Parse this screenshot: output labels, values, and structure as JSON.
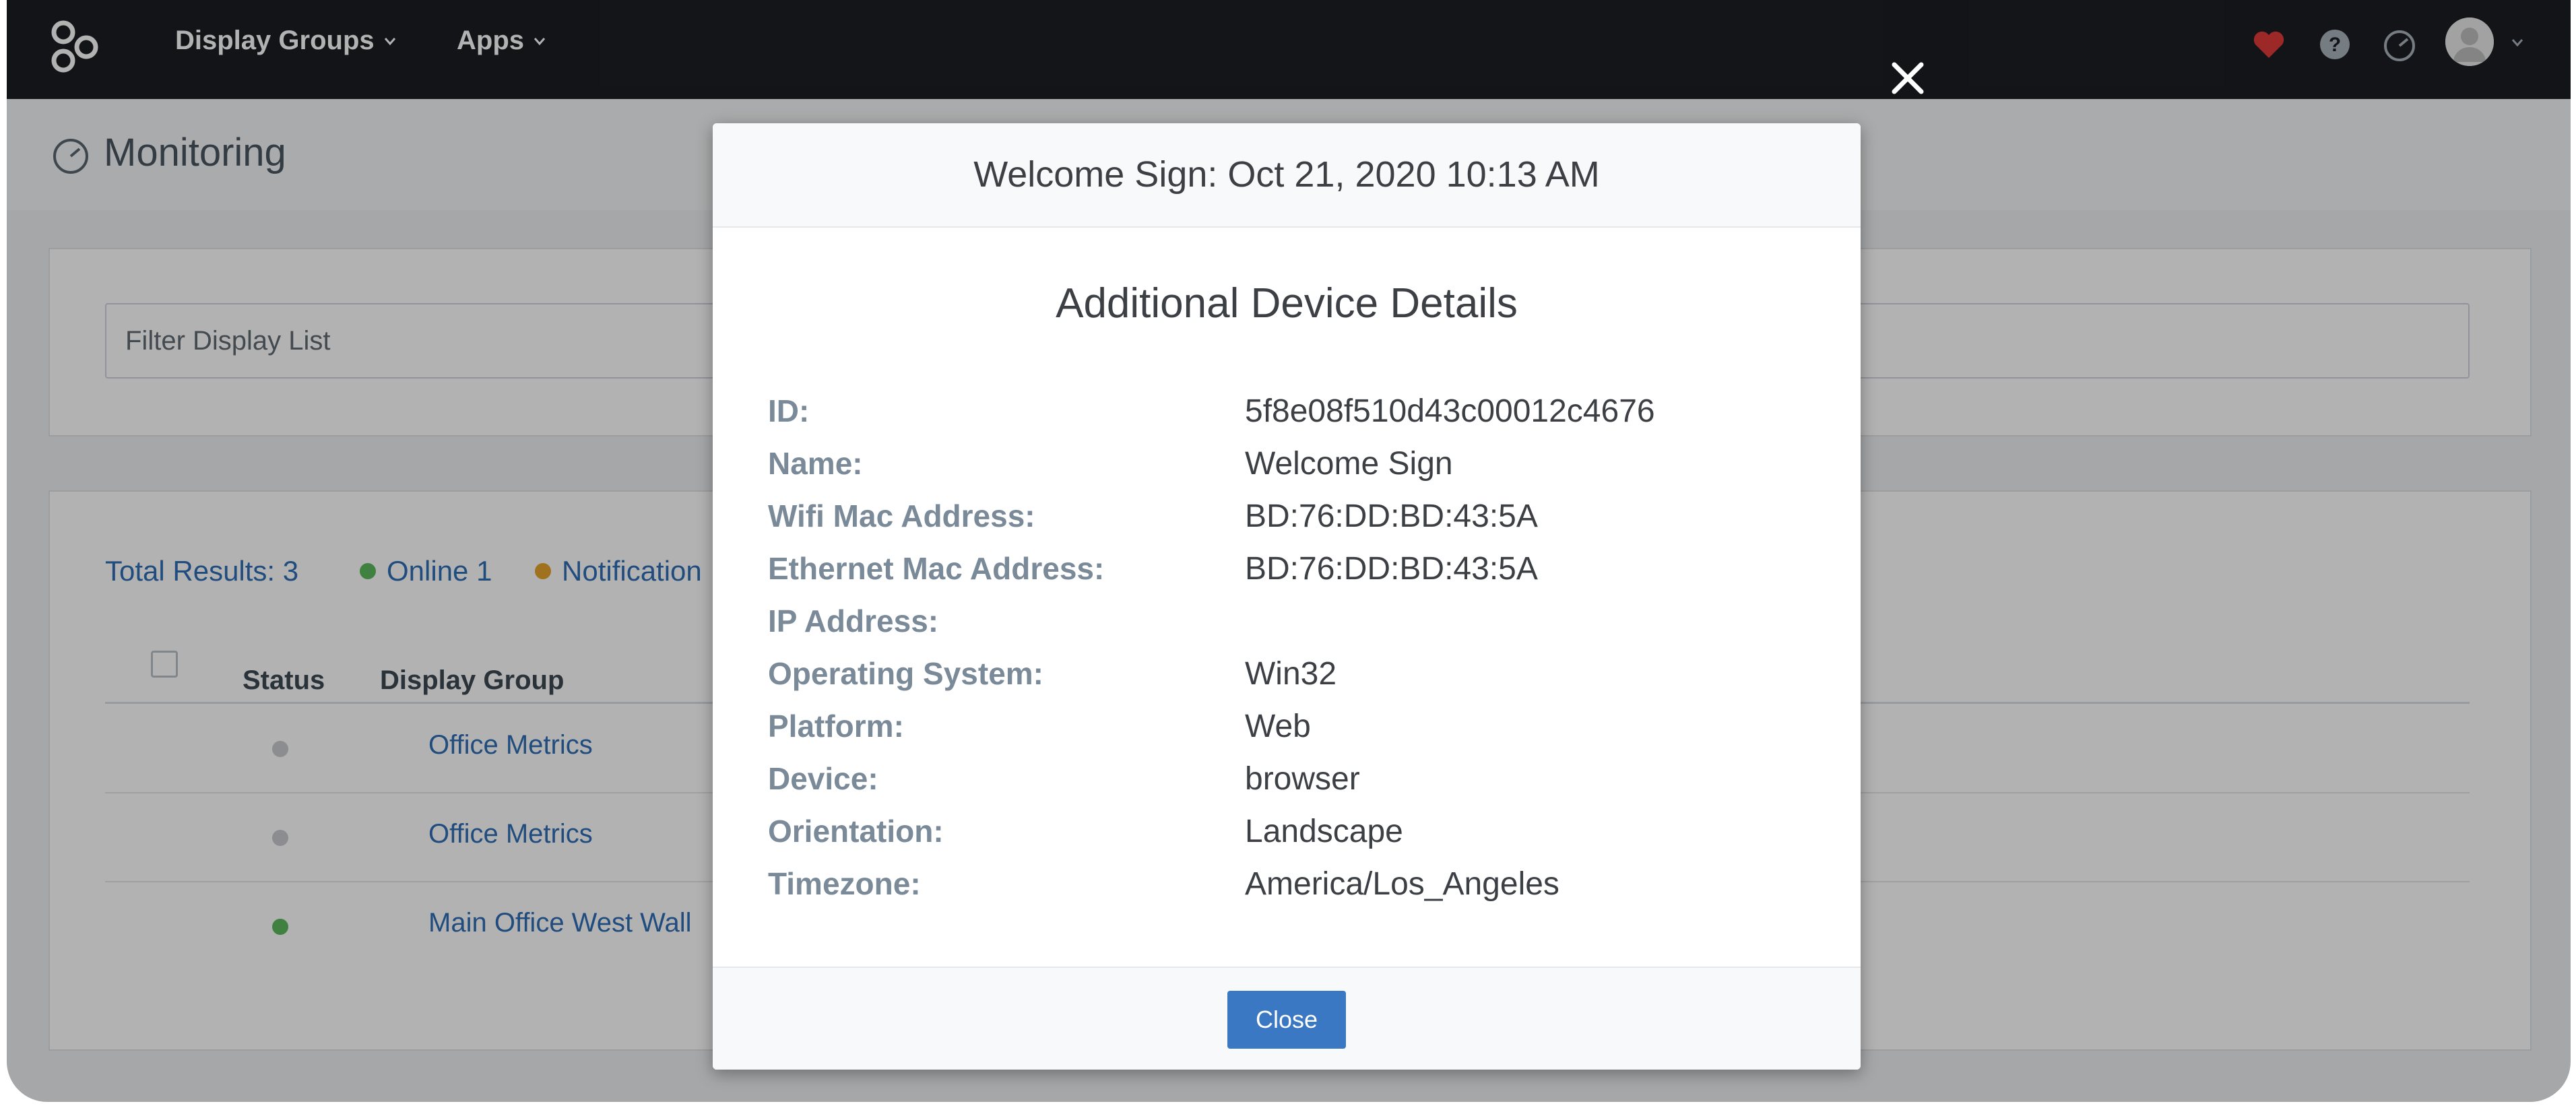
{
  "nav": {
    "display_groups_label": "Display Groups",
    "apps_label": "Apps",
    "heart_color": "#e03a3a"
  },
  "page": {
    "title": "Monitoring"
  },
  "filter": {
    "placeholder": "Filter Display List"
  },
  "summary": {
    "total_results": "Total Results: 3",
    "online": "Online 1",
    "notification": "Notification",
    "online_color": "#5cb85c",
    "notification_color": "#e5a32b"
  },
  "table": {
    "headers": {
      "status": "Status",
      "display_group": "Display Group"
    },
    "rows": [
      {
        "status_color": "#c7cbcf",
        "display_group": "Office Metrics"
      },
      {
        "status_color": "#c7cbcf",
        "display_group": "Office Metrics"
      },
      {
        "status_color": "#5cb85c",
        "display_group": "Main Office West Wall"
      }
    ]
  },
  "modal": {
    "header": "Welcome Sign: Oct 21, 2020 10:13 AM",
    "title": "Additional Device Details",
    "details": [
      {
        "key": "ID:",
        "value": "5f8e08f510d43c00012c4676"
      },
      {
        "key": "Name:",
        "value": "Welcome Sign"
      },
      {
        "key": "Wifi Mac Address:",
        "value": "BD:76:DD:BD:43:5A"
      },
      {
        "key": "Ethernet Mac Address:",
        "value": "BD:76:DD:BD:43:5A"
      },
      {
        "key": "IP Address:",
        "value": ""
      },
      {
        "key": "Operating System:",
        "value": "Win32"
      },
      {
        "key": "Platform:",
        "value": "Web"
      },
      {
        "key": "Device:",
        "value": "browser"
      },
      {
        "key": "Orientation:",
        "value": "Landscape"
      },
      {
        "key": "Timezone:",
        "value": "America/Los_Angeles"
      }
    ],
    "close_label": "Close"
  }
}
